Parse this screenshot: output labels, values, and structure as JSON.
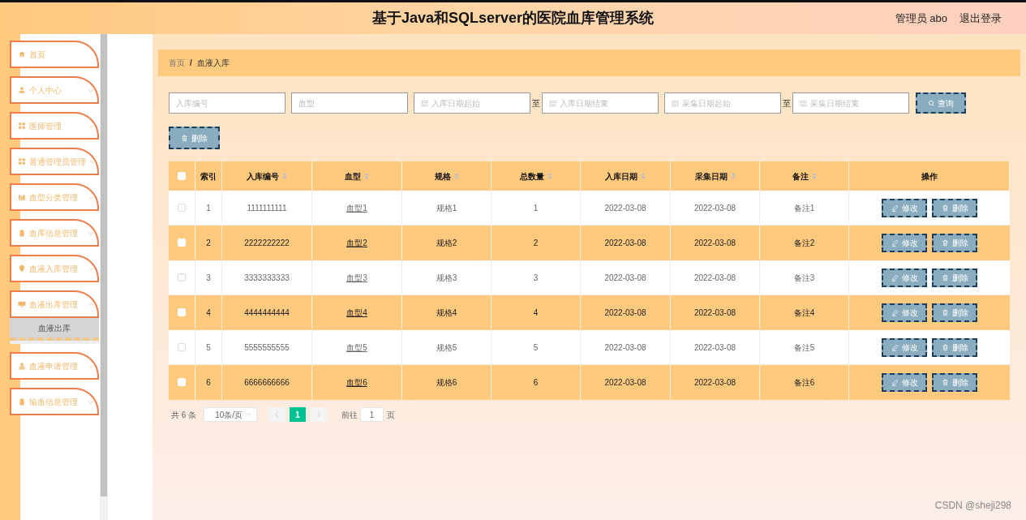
{
  "header": {
    "title": "基于Java和SQLserver的医院血库管理系统",
    "user": "管理员 abo",
    "logout": "退出登录"
  },
  "sidebar": {
    "items": [
      {
        "label": "首页"
      },
      {
        "label": "个人中心",
        "expanded": false
      },
      {
        "label": "医师管理",
        "expanded": false
      },
      {
        "label": "普通管理员管理",
        "expanded": false
      },
      {
        "label": "血型分类管理",
        "expanded": false
      },
      {
        "label": "血库信息管理",
        "expanded": false
      },
      {
        "label": "血液入库管理",
        "expanded": false
      },
      {
        "label": "血液出库管理",
        "expanded": true,
        "children": [
          {
            "label": "血液出库",
            "selected": true
          }
        ]
      },
      {
        "label": "血液申请管理",
        "expanded": false
      },
      {
        "label": "输血信息管理",
        "expanded": false
      }
    ]
  },
  "breadcrumb": {
    "items": [
      "首页",
      "血液入库"
    ],
    "separator": "/"
  },
  "filters": [
    {
      "kind": "text",
      "placeholder": "入库编号"
    },
    {
      "kind": "text",
      "placeholder": "血型"
    },
    {
      "kind": "date",
      "placeholder": "入库日期起始"
    },
    {
      "kind": "sep",
      "text": "至"
    },
    {
      "kind": "date",
      "placeholder": "入库日期结束"
    },
    {
      "kind": "date",
      "placeholder": "采集日期起始"
    },
    {
      "kind": "sep",
      "text": "至"
    },
    {
      "kind": "date",
      "placeholder": "采集日期结束"
    }
  ],
  "search_button": "查询",
  "delete_button": "删除",
  "table": {
    "header_checked": false,
    "columns": [
      {
        "label": "索引",
        "sortable": false
      },
      {
        "label": "入库编号",
        "sortable": true
      },
      {
        "label": "血型",
        "sortable": true
      },
      {
        "label": "规格",
        "sortable": true
      },
      {
        "label": "总数量",
        "sortable": true
      },
      {
        "label": "入库日期",
        "sortable": true
      },
      {
        "label": "采集日期",
        "sortable": true
      },
      {
        "label": "备注",
        "sortable": true
      },
      {
        "label": "操作",
        "sortable": false
      }
    ],
    "rows": [
      {
        "checked": false,
        "cells": [
          "1",
          "1111111111",
          "血型1",
          "规格1",
          "1",
          "2022-03-08",
          "2022-03-08",
          "备注1"
        ],
        "actions": [
          "修改",
          "删除"
        ]
      },
      {
        "checked": false,
        "cells": [
          "2",
          "2222222222",
          "血型2",
          "规格2",
          "2",
          "2022-03-08",
          "2022-03-08",
          "备注2"
        ],
        "actions": [
          "修改",
          "删除"
        ]
      },
      {
        "checked": false,
        "cells": [
          "3",
          "3333333333",
          "血型3",
          "规格3",
          "3",
          "2022-03-08",
          "2022-03-08",
          "备注3"
        ],
        "actions": [
          "修改",
          "删除"
        ]
      },
      {
        "checked": false,
        "cells": [
          "4",
          "4444444444",
          "血型4",
          "规格4",
          "4",
          "2022-03-08",
          "2022-03-08",
          "备注4"
        ],
        "actions": [
          "修改",
          "删除"
        ]
      },
      {
        "checked": false,
        "cells": [
          "5",
          "5555555555",
          "血型5",
          "规格5",
          "5",
          "2022-03-08",
          "2022-03-08",
          "备注5"
        ],
        "actions": [
          "修改",
          "删除"
        ]
      },
      {
        "checked": false,
        "cells": [
          "6",
          "6666666666",
          "血型6",
          "规格6",
          "6",
          "2022-03-08",
          "2022-03-08",
          "备注6"
        ],
        "actions": [
          "修改",
          "删除"
        ]
      }
    ]
  },
  "pagination": {
    "total": "共 6 条",
    "page_size": "10条/页",
    "pages": [
      {
        "label": "1",
        "selected": true
      }
    ],
    "goto_label": "前往",
    "goto_value": "1",
    "goto_suffix": "页"
  },
  "watermark_credit": "CSDN @sheji298"
}
